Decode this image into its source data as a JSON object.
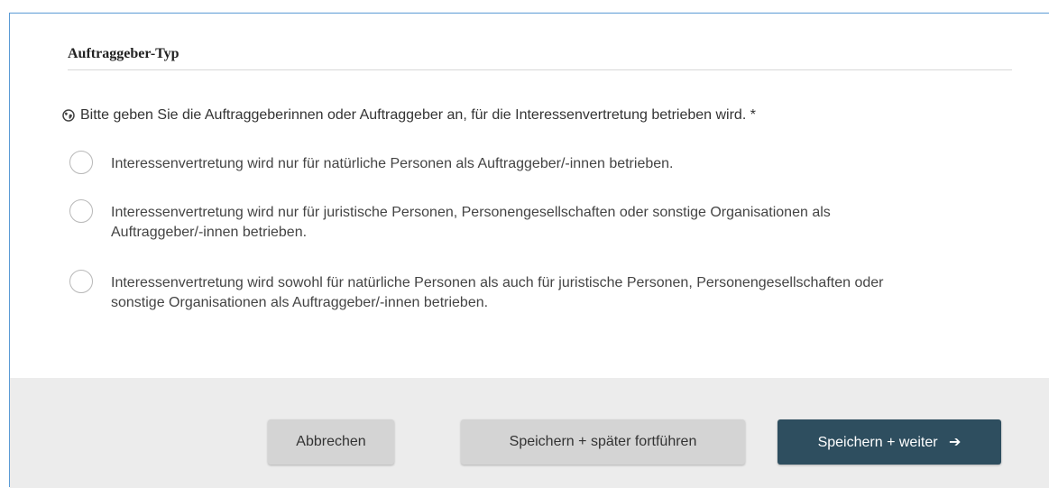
{
  "section": {
    "title": "Auftraggeber-Typ"
  },
  "question": {
    "text": "Bitte geben Sie die Auftraggeberinnen oder Auftraggeber an, für die Interessenvertretung betrieben wird. *",
    "icon": "globe-icon"
  },
  "options": [
    {
      "label": "Interessenvertretung wird nur für natürliche Personen als Auftraggeber/-innen betrieben.",
      "selected": false
    },
    {
      "label": "Interessenvertretung wird nur für juristische Personen, Personengesellschaften oder sonstige Organisationen als Auftraggeber/-innen betrieben.",
      "selected": false
    },
    {
      "label": "Interessenvertretung wird sowohl für natürliche Personen als auch für juristische Personen, Personengesellschaften oder sonstige Organisationen als Auftraggeber/-innen betrieben.",
      "selected": false
    }
  ],
  "footer": {
    "cancel_label": "Abbrechen",
    "save_later_label": "Speichern + später fortführen",
    "save_next_label": "Speichern + weiter",
    "save_next_icon": "arrow-right-icon"
  },
  "colors": {
    "primary_button": "#2e4e5f",
    "secondary_button": "#d4d4d4",
    "footer_background": "#ececec",
    "frame_border": "#5b9bd5"
  }
}
